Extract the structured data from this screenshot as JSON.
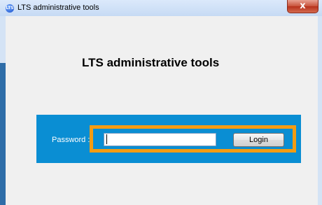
{
  "window": {
    "title": "LTS administrative tools",
    "app_icon_text": "LTS",
    "close_glyph": "x"
  },
  "main": {
    "heading": "LTS administrative tools"
  },
  "login": {
    "password_label": "Password :",
    "password_value": "",
    "login_button": "Login"
  },
  "colors": {
    "panel": "#0a8ed3",
    "highlight": "#f39c12",
    "close_button": "#c8523a"
  },
  "icons": {
    "app": "lts-app-icon",
    "close": "close-icon"
  }
}
